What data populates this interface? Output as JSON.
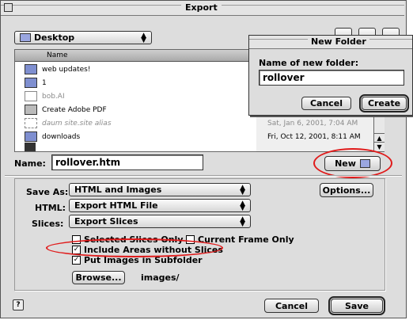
{
  "window": {
    "title": "Export"
  },
  "location": {
    "selected": "Desktop"
  },
  "file_list": {
    "header": "Name",
    "items": [
      {
        "name": "web updates!",
        "icon": "folder-icon",
        "date": "",
        "dim": false
      },
      {
        "name": "1",
        "icon": "folder-icon",
        "date": "",
        "dim": false
      },
      {
        "name": "bob.AI",
        "icon": "document-icon",
        "date": "",
        "dim": true
      },
      {
        "name": "Create Adobe PDF",
        "icon": "printer-icon",
        "date": "",
        "dim": false
      },
      {
        "name": "daum site.site alias",
        "icon": "alias-icon",
        "date": "Sat, Jan 6, 2001, 7:04 AM",
        "dim": true
      },
      {
        "name": "downloads",
        "icon": "folder-icon",
        "date": "Fri, Oct 12, 2001, 8:11 AM",
        "dim": false
      }
    ]
  },
  "name_field": {
    "label": "Name:",
    "value": "rollover.htm"
  },
  "new_button": {
    "label": "New"
  },
  "save_as": {
    "label": "Save As:",
    "value": "HTML and Images"
  },
  "html": {
    "label": "HTML:",
    "value": "Export HTML File"
  },
  "slices": {
    "label": "Slices:",
    "value": "Export Slices"
  },
  "options_button": {
    "label": "Options..."
  },
  "checkboxes": {
    "selected_slices_only": {
      "label": "Selected Slices Only",
      "checked": false
    },
    "current_frame_only": {
      "label": "Current Frame Only",
      "checked": false
    },
    "include_areas": {
      "label": "Include Areas without Slices",
      "checked": true
    },
    "put_images": {
      "label": "Put Images in Subfolder",
      "checked": true
    }
  },
  "browse_button": {
    "label": "Browse..."
  },
  "images_folder": "images/",
  "cancel_button": {
    "label": "Cancel"
  },
  "save_button": {
    "label": "Save"
  },
  "new_folder_dialog": {
    "title": "New Folder",
    "prompt": "Name of new folder:",
    "value": "rollover",
    "cancel_label": "Cancel",
    "create_label": "Create"
  },
  "check_mark": "✓",
  "colors": {
    "highlight": "#e01a1a",
    "folder": "#7f8fd0"
  }
}
